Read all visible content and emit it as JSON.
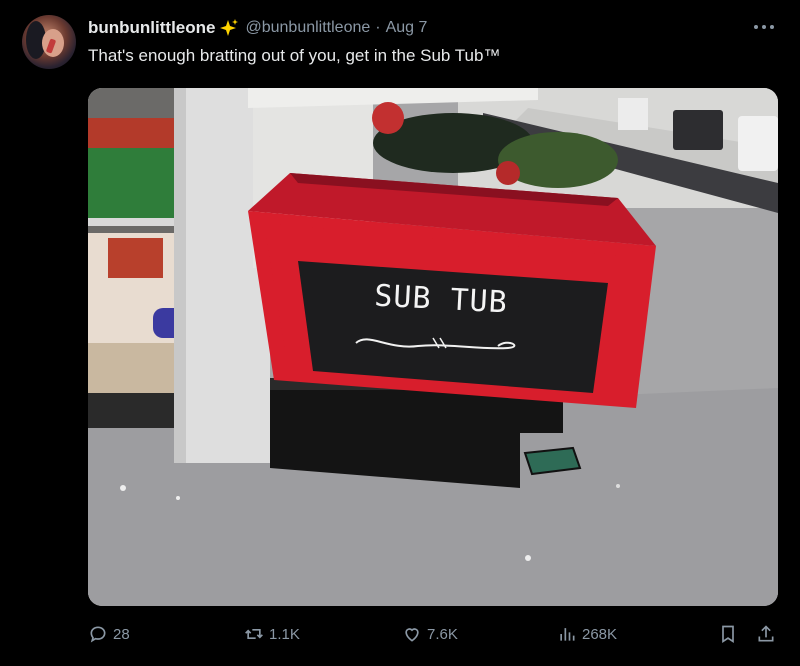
{
  "post": {
    "display_name": "bunbunlittleone",
    "handle": "@bunbunlittleone",
    "separator": "·",
    "date": "Aug 7",
    "text": "That's enough bratting out of you, get in the Sub Tub™"
  },
  "image": {
    "sign_text": "SUB TUB",
    "bin_color": "#d81e2c"
  },
  "actions": {
    "replies": "28",
    "reposts": "1.1K",
    "likes": "7.6K",
    "views": "268K"
  },
  "icons": [
    "avatar",
    "sparkle-icon",
    "more-icon",
    "reply-icon",
    "repost-icon",
    "like-icon",
    "views-icon",
    "bookmark-icon",
    "share-icon"
  ],
  "colors": {
    "background": "#000000",
    "text": "#e7e9ea",
    "muted": "#8b98a5",
    "sparkle": "#ffd400"
  }
}
